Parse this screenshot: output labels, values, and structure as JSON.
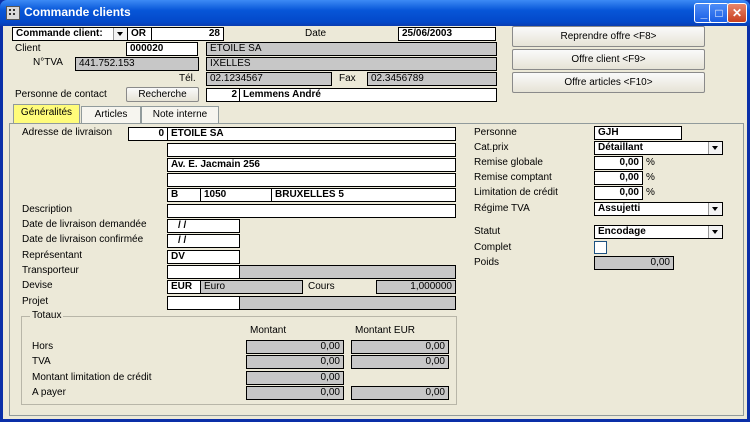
{
  "window": {
    "title": "Commande clients"
  },
  "header": {
    "doc_type": "Commande client:",
    "series": "OR",
    "number": "28",
    "date_label": "Date",
    "date_value": "25/06/2003",
    "client_label": "Client",
    "client_code": "000020",
    "client_name": "ETOILE SA",
    "tva_label": "N°TVA",
    "tva_value": "441.752.153",
    "city": "IXELLES",
    "tel_label": "Tél.",
    "tel_value": "02.1234567",
    "fax_label": "Fax",
    "fax_value": "02.3456789",
    "contact_label": "Personne de contact",
    "search_button": "Recherche",
    "contact_num": "2",
    "contact_name": "Lemmens André",
    "btn_reprendre": "Reprendre offre <F8>",
    "btn_offre_client": "Offre client <F9>",
    "btn_offre_articles": "Offre articles <F10>"
  },
  "tabs": [
    {
      "label": "Généralités",
      "active": true
    },
    {
      "label": "Articles",
      "active": false
    },
    {
      "label": "Note interne",
      "active": false
    }
  ],
  "general": {
    "adresse_label": "Adresse de livraison",
    "adresse_num": "0",
    "adresse_nom": "ETOILE SA",
    "adresse_l2": "",
    "rue": "Av. E. Jacmain 256",
    "adresse_l4": "",
    "pays": "B",
    "cp": "1050",
    "ville": "BRUXELLES 5",
    "description_label": "Description",
    "date_demandee_label": "Date de livraison demandée",
    "date_demandee": "/ /",
    "date_confirmee_label": "Date de livraison confirmée",
    "date_confirmee": "/ /",
    "representant_label": "Représentant",
    "representant": "DV",
    "transporteur_label": "Transporteur",
    "devise_label": "Devise",
    "devise_code": "EUR",
    "devise_name": "Euro",
    "cours_label": "Cours",
    "cours_value": "1,000000",
    "projet_label": "Projet"
  },
  "totaux": {
    "title": "Totaux",
    "col_montant": "Montant",
    "col_montant_eur": "Montant EUR",
    "rows": [
      {
        "label": "Hors",
        "montant": "0,00",
        "montant_eur": "0,00"
      },
      {
        "label": "TVA",
        "montant": "0,00",
        "montant_eur": "0,00"
      },
      {
        "label": "Montant limitation de crédit",
        "montant": "0,00",
        "montant_eur": ""
      },
      {
        "label": "A payer",
        "montant": "0,00",
        "montant_eur": "0,00"
      }
    ]
  },
  "right": {
    "personne_label": "Personne",
    "personne": "GJH",
    "catprix_label": "Cat.prix",
    "catprix": "Détaillant",
    "remise_globale_label": "Remise globale",
    "remise_globale": "0,00",
    "remise_comptant_label": "Remise comptant",
    "remise_comptant": "0,00",
    "limitation_label": "Limitation de crédit",
    "limitation": "0,00",
    "pct": "%",
    "regime_label": "Régime TVA",
    "regime": "Assujetti",
    "statut_label": "Statut",
    "statut": "Encodage",
    "complet_label": "Complet",
    "poids_label": "Poids",
    "poids": "0,00"
  },
  "colors": {
    "titlebar": "#0756d8",
    "active_tab": "#fffc7a",
    "readonly": "#c7c7c7"
  }
}
